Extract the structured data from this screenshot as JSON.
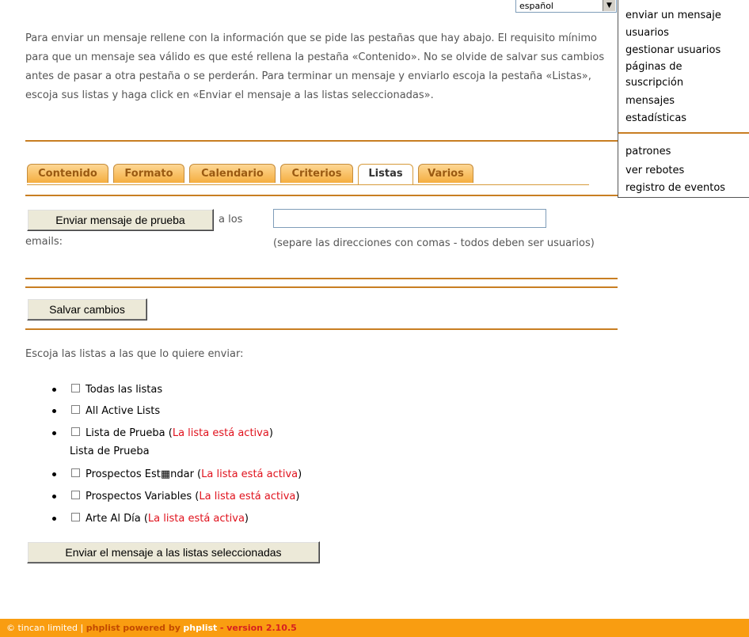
{
  "language": {
    "selected": "español"
  },
  "intro_text": "Para enviar un mensaje rellene con la información que se pide las pestañas que hay abajo. El requisito mínimo para que un mensaje sea válido es que esté rellena la pestaña «Contenido». No se olvide de salvar sus cambios antes de pasar a otra pestaña o se perderán. Para terminar un mensaje y enviarlo escoja la pestaña «Listas», escoja sus listas y haga click en «Enviar el mensaje a las listas seleccionadas».",
  "tabs": [
    "Contenido",
    "Formato",
    "Calendario",
    "Criterios",
    "Listas",
    "Varios"
  ],
  "active_tab": "Listas",
  "test": {
    "button_label": "Enviar mensaje de prueba",
    "label_suffix": "a los",
    "label_line2": "emails:",
    "email_value": "",
    "help": "(separe las direcciones con comas - todos deben ser usuarios)"
  },
  "save_button": "Salvar cambios",
  "choose_lists_label": "Escoja las listas a las que lo quiere enviar:",
  "lists": [
    {
      "name": "Todas las listas",
      "status": "",
      "checked": false
    },
    {
      "name": "All Active Lists",
      "status": "",
      "checked": false
    },
    {
      "name": "Lista de Prueba",
      "status": "La lista está activa",
      "checked": false
    },
    {
      "name": "Prospectos Est▦ndar",
      "status": "La lista está activa",
      "checked": false
    },
    {
      "name": "Prospectos Variables",
      "status": "La lista está activa",
      "checked": false
    },
    {
      "name": "Arte Al Día",
      "status": "La lista está activa",
      "checked": false
    }
  ],
  "list_description": "Lista de Prueba",
  "send_button": "Enviar el mensaje a las listas seleccionadas",
  "sidebar": {
    "items": [
      "enviar un mensaje",
      "usuarios",
      "gestionar usuarios",
      "páginas de suscripción",
      "mensajes",
      "estadísticas"
    ],
    "items2": [
      "patrones",
      "ver rebotes",
      "registro de eventos"
    ]
  },
  "footer": {
    "company": "© tincan limited",
    "sep": "|",
    "product": "phplist",
    "powered": "powered by",
    "product2": "phplist",
    "version": "- version 2.10.5"
  }
}
